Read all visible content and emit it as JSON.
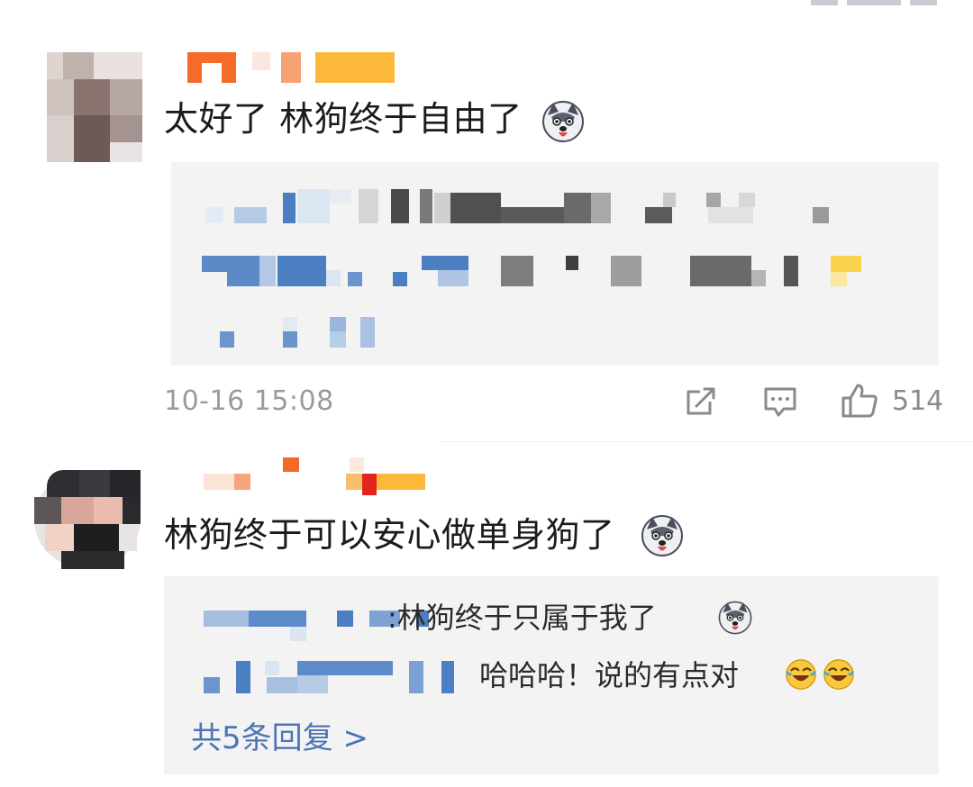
{
  "comments": [
    {
      "text": "太好了 林狗终于自由了",
      "emoji": "husky-emoji",
      "time": "10-16 15:08",
      "likes": "514"
    },
    {
      "text": "林狗终于可以安心做单身狗了",
      "emoji": "husky-emoji",
      "replies": [
        {
          "separator": ":",
          "text": "林狗终于只属于我了",
          "emoji": "husky-emoji"
        },
        {
          "text": "哈哈哈！说的有点对",
          "emoji": "laugh-cry-emoji"
        }
      ],
      "more_replies": "共5条回复 >"
    }
  ],
  "icons": {
    "share": "share-icon",
    "comment": "comment-icon",
    "like": "thumbs-up-icon"
  },
  "colors": {
    "link": "#4d74b5",
    "timestamp": "#9b9b9b",
    "panel": "#f3f3f3"
  }
}
